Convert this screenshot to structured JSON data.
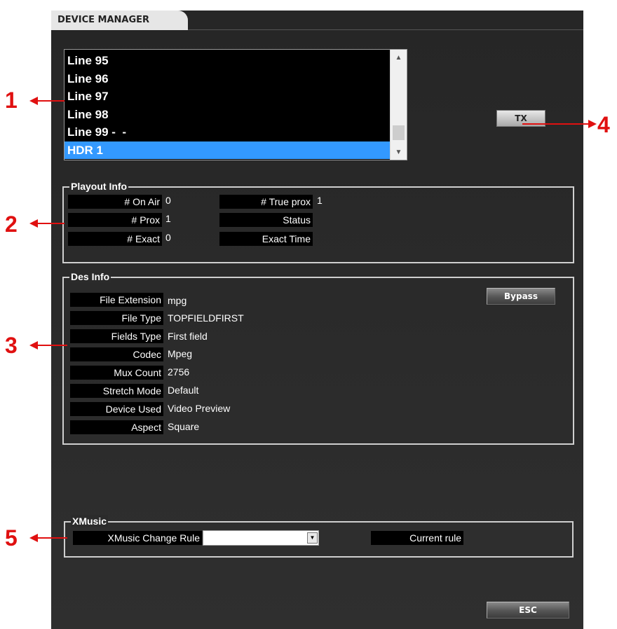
{
  "window": {
    "title": "DEVICE MANAGER"
  },
  "line_list": {
    "items": [
      "Line 95",
      "Line 96",
      "Line 97",
      "Line 98",
      "Line 99 -  -",
      "HDR 1"
    ],
    "selected": "HDR 1"
  },
  "buttons": {
    "tx": "TX",
    "bypass": "Bypass",
    "esc": "ESC"
  },
  "playout_info": {
    "title": "Playout Info",
    "on_air_label": "# On Air",
    "on_air_value": "0",
    "prox_label": "# Prox",
    "prox_value": "1",
    "exact_label": "# Exact",
    "exact_value": "0",
    "true_prox_label": "# True prox",
    "true_prox_value": "1",
    "status_label": "Status",
    "exact_time_label": "Exact Time"
  },
  "des_info": {
    "title": "Des Info",
    "rows": [
      {
        "label": "File Extension",
        "value": "mpg"
      },
      {
        "label": "File Type",
        "value": "TOPFIELDFIRST"
      },
      {
        "label": "Fields Type",
        "value": "First field"
      },
      {
        "label": "Codec",
        "value": "Mpeg"
      },
      {
        "label": "Mux Count",
        "value": "2756"
      },
      {
        "label": "Stretch Mode",
        "value": "Default"
      },
      {
        "label": "Device Used",
        "value": "Video Preview"
      },
      {
        "label": "Aspect",
        "value": "Square"
      }
    ]
  },
  "xmusic": {
    "title": "XMusic",
    "change_rule_label": "XMusic Change Rule",
    "change_rule_value": "",
    "current_rule_label": "Current rule"
  },
  "callouts": [
    "1",
    "2",
    "3",
    "4",
    "5"
  ],
  "colors": {
    "callout": "#e01010",
    "selection": "#3399ff",
    "window_bg": "#2b2b2b"
  }
}
